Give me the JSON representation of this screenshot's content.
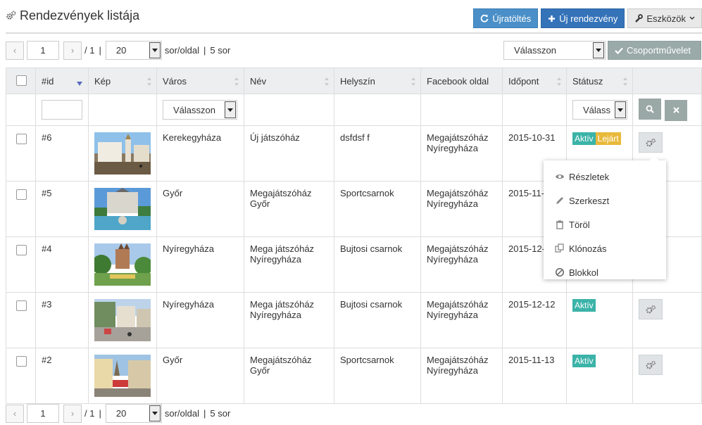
{
  "page": {
    "title": "Rendezvények listája"
  },
  "toolbar": {
    "refresh": "Újratöltés",
    "new_event": "Új rendezvény",
    "tools": "Eszközök"
  },
  "pager": {
    "page": "1",
    "total": "/ 1",
    "sep": "|",
    "per_page": "20",
    "per_page_label": "sor/oldal",
    "sep2": "|",
    "rows": "5 sor"
  },
  "bulk": {
    "select": "Válasszon",
    "action": "Csoportművelet"
  },
  "table": {
    "headers": {
      "id": "#id",
      "image": "Kép",
      "city": "Város",
      "name": "Név",
      "venue": "Helyszín",
      "facebook": "Facebook oldal",
      "date": "Időpont",
      "status": "Státusz"
    },
    "filters": {
      "city": "Válasszon",
      "status": "Válass"
    },
    "rows": [
      {
        "id": "#6",
        "city": "Kerekegyháza",
        "name": "Új játszóház",
        "venue": "dsfdsf f",
        "facebook": "Megajátszóház Nyíregyháza",
        "date": "2015-10-31",
        "status": "Aktív",
        "status2": "Lejárt"
      },
      {
        "id": "#5",
        "city": "Győr",
        "name": "Megajátszóház Győr",
        "venue": "Sportcsarnok",
        "facebook": "Megajátszóház Nyíregyháza",
        "date": "2015-11-",
        "status": ""
      },
      {
        "id": "#4",
        "city": "Nyíregyháza",
        "name": "Mega játszóház Nyíregyháza",
        "venue": "Bujtosi csarnok",
        "facebook": "Megajátszóház Nyíregyháza",
        "date": "2015-12-",
        "status": ""
      },
      {
        "id": "#3",
        "city": "Nyíregyháza",
        "name": "Mega játszóház Nyíregyháza",
        "venue": "Bujtosi csarnok",
        "facebook": "Megajátszóház Nyíregyháza",
        "date": "2015-12-12",
        "status": "Aktív"
      },
      {
        "id": "#2",
        "city": "Győr",
        "name": "Megajátszóház Győr",
        "venue": "Sportcsarnok",
        "facebook": "Megajátszóház Nyíregyháza",
        "date": "2015-11-13",
        "status": "Aktív"
      }
    ]
  },
  "menu": {
    "details": "Részletek",
    "edit": "Szerkeszt",
    "delete": "Töröl",
    "clone": "Klónozás",
    "block": "Blokkol"
  },
  "colors": {
    "info": "#4a8fc7",
    "primary": "#3573b9",
    "badge_active": "#3bb3a8",
    "badge_expired": "#e8b93a"
  },
  "icons": {
    "refresh": "refresh-icon",
    "plus": "plus-icon",
    "wrench": "wrench-icon",
    "check": "check-icon",
    "search": "search-icon",
    "close": "close-icon",
    "gears": "gears-icon"
  }
}
